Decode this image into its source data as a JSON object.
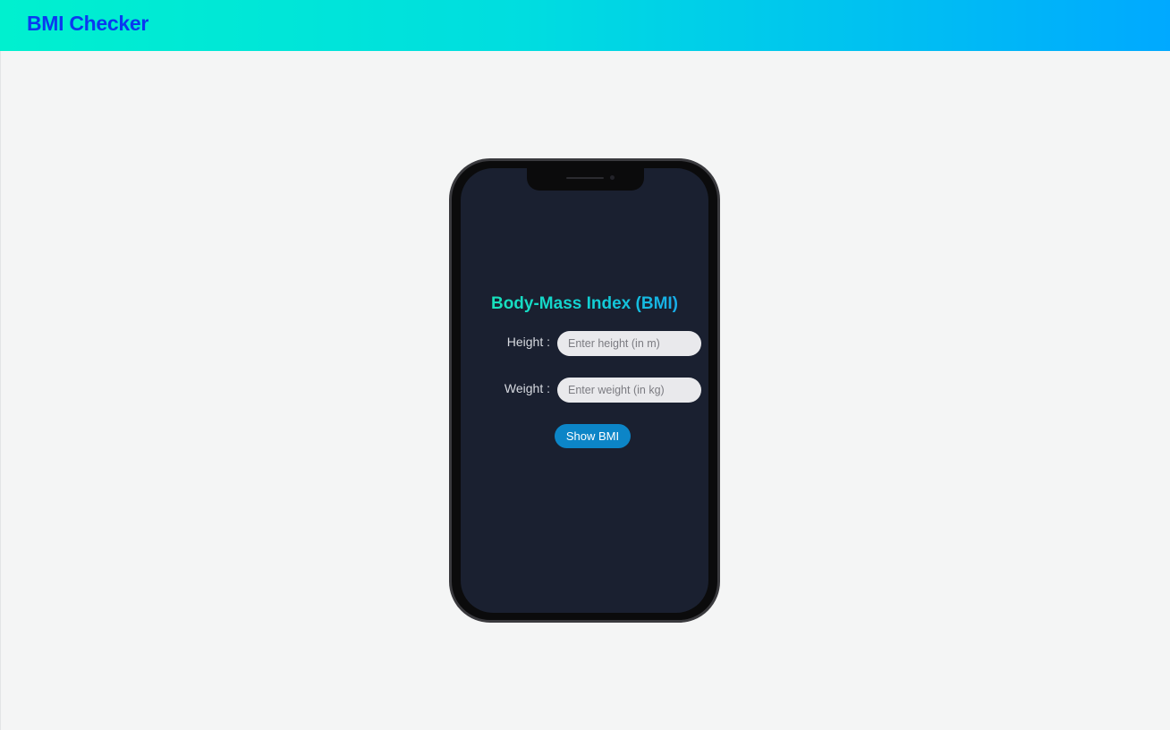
{
  "app": {
    "title": "BMI Checker"
  },
  "phone": {
    "heading": "Body-Mass Index (BMI)",
    "height": {
      "label": "Height :",
      "placeholder": "Enter height (in m)",
      "value": ""
    },
    "weight": {
      "label": "Weight :",
      "placeholder": "Enter weight (in kg)",
      "value": ""
    },
    "button_label": "Show BMI"
  },
  "colors": {
    "header_gradient_start": "#00f0cf",
    "header_gradient_end": "#00a9ff",
    "brand_text": "#0a39f0",
    "screen_bg": "#1a2030",
    "button_bg": "#0c85c7",
    "heading_gradient_start": "#19e7b4",
    "heading_gradient_end": "#1a9ff0"
  }
}
